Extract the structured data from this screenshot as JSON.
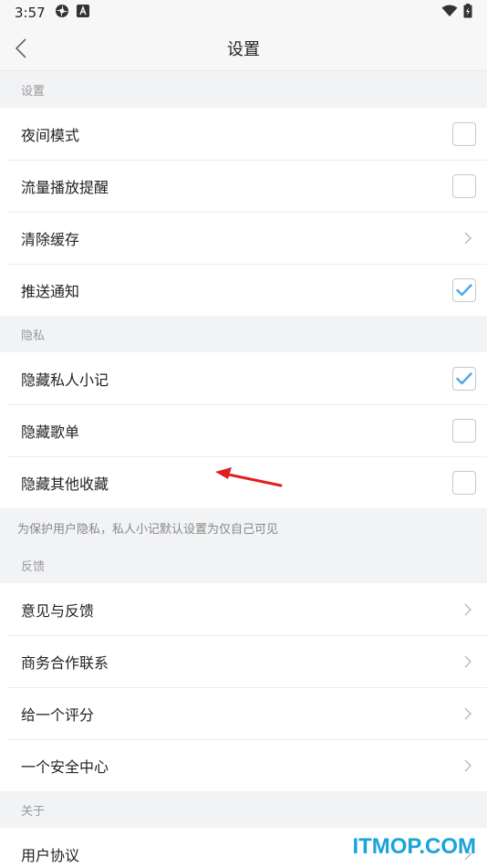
{
  "status_bar": {
    "time": "3:57"
  },
  "nav": {
    "title": "设置"
  },
  "sections": {
    "settings": {
      "header": "设置",
      "items": [
        {
          "label": "夜间模式",
          "control": "checkbox",
          "checked": false
        },
        {
          "label": "流量播放提醒",
          "control": "checkbox",
          "checked": false
        },
        {
          "label": "清除缓存",
          "control": "chevron"
        },
        {
          "label": "推送通知",
          "control": "checkbox",
          "checked": true
        }
      ]
    },
    "privacy": {
      "header": "隐私",
      "items": [
        {
          "label": "隐藏私人小记",
          "control": "checkbox",
          "checked": true
        },
        {
          "label": "隐藏歌单",
          "control": "checkbox",
          "checked": false
        },
        {
          "label": "隐藏其他收藏",
          "control": "checkbox",
          "checked": false
        }
      ],
      "note": "为保护用户隐私，私人小记默认设置为仅自己可见"
    },
    "feedback": {
      "header": "反馈",
      "items": [
        {
          "label": "意见与反馈",
          "control": "chevron"
        },
        {
          "label": "商务合作联系",
          "control": "chevron"
        },
        {
          "label": "给一个评分",
          "control": "chevron"
        },
        {
          "label": "一个安全中心",
          "control": "chevron"
        }
      ]
    },
    "about": {
      "header": "关于",
      "items": [
        {
          "label": "用户协议",
          "control": "chevron"
        }
      ]
    }
  },
  "watermark": "ITMOP.COM",
  "colors": {
    "accent_check": "#4da6e8",
    "annotation_arrow": "#e02020",
    "watermark": "#1aa3d9"
  },
  "icons": {
    "status_left": [
      "settings-gear-icon",
      "app-a-icon"
    ],
    "status_right": [
      "wifi-icon",
      "battery-icon"
    ]
  }
}
